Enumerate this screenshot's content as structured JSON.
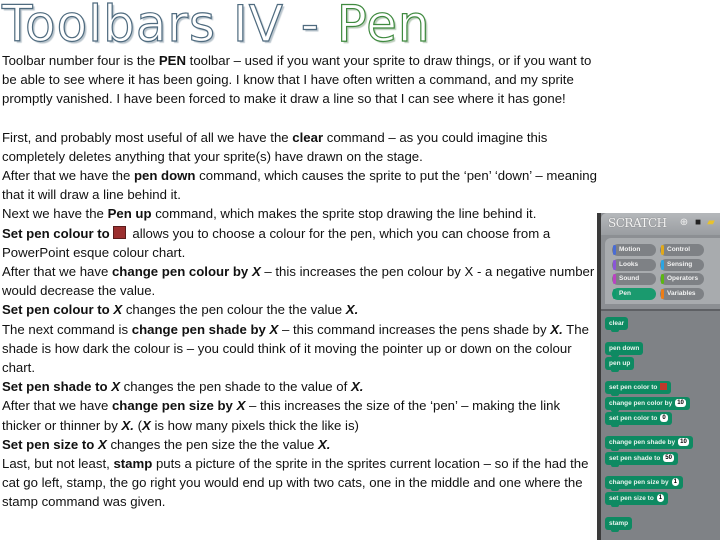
{
  "title": {
    "main": "Toolbars IV - ",
    "accent": "Pen"
  },
  "paragraphs": [
    [
      {
        "t": "Toolbar number four is the "
      },
      {
        "t": "PEN",
        "b": true
      },
      {
        "t": " toolbar – used if you want your sprite to draw things, or if you want to be able to see where it has been going.  I know that I have often written a command, and my sprite promptly vanished.  I have been forced to make it draw a line so that I can see where it has gone!"
      }
    ],
    null,
    [
      {
        "t": "First, and probably most useful of all we have the "
      },
      {
        "t": "clear",
        "b": true
      },
      {
        "t": " command – as you could imagine this completely deletes anything that your sprite(s) have drawn on the stage."
      }
    ],
    [
      {
        "t": "After that we have the "
      },
      {
        "t": "pen down",
        "b": true
      },
      {
        "t": " command, which causes the sprite to put the ‘pen’ ‘down’ – meaning that it will draw a line behind it."
      }
    ],
    [
      {
        "t": "Next we have the "
      },
      {
        "t": "Pen up",
        "b": true
      },
      {
        "t": " command, which makes the sprite stop drawing the line behind it."
      }
    ],
    [
      {
        "t": "Set pen colour to",
        "b": true
      },
      {
        "swatch": true
      },
      {
        "t": " allows you to choose a colour for the pen, which you can choose from a PowerPoint esque  colour chart."
      }
    ],
    [
      {
        "t": "After that we have "
      },
      {
        "t": "change pen colour by ",
        "b": true
      },
      {
        "t": "X",
        "b": true,
        "i": true
      },
      {
        "t": " – this increases the pen colour by X - a negative number would decrease the value."
      }
    ],
    [
      {
        "t": "Set pen colour to ",
        "b": true
      },
      {
        "t": "X",
        "b": true,
        "i": true
      },
      {
        "t": " changes the pen colour the the value "
      },
      {
        "t": "X.",
        "b": true,
        "i": true
      }
    ],
    [
      {
        "t": "The next command is "
      },
      {
        "t": "change pen shade by ",
        "b": true
      },
      {
        "t": "X",
        "b": true,
        "i": true
      },
      {
        "t": " – this command increases the pens shade by "
      },
      {
        "t": "X.",
        "b": true,
        "i": true
      },
      {
        "t": " The shade is how dark the colour is – you could think of it moving the pointer up or down on the colour chart."
      }
    ],
    [
      {
        "t": "Set pen shade to ",
        "b": true
      },
      {
        "t": "X",
        "b": true,
        "i": true
      },
      {
        "t": " changes the pen shade to the value of "
      },
      {
        "t": "X.",
        "b": true,
        "i": true
      }
    ],
    [
      {
        "t": "After that we have "
      },
      {
        "t": "change pen size by ",
        "b": true
      },
      {
        "t": "X",
        "b": true,
        "i": true
      },
      {
        "t": " – this increases the size of the ‘pen’ – making the link thicker or thinner by "
      },
      {
        "t": "X.",
        "b": true,
        "i": true
      },
      {
        "t": "  ("
      },
      {
        "t": "X",
        "b": true,
        "i": true
      },
      {
        "t": " is how many pixels thick the like is)"
      }
    ],
    [
      {
        "t": "Set pen size to ",
        "b": true
      },
      {
        "t": "X",
        "b": true,
        "i": true
      },
      {
        "t": " changes the pen size the the value "
      },
      {
        "t": "X.",
        "b": true,
        "i": true
      }
    ],
    [
      {
        "t": "Last, but not least, "
      },
      {
        "t": "stamp",
        "b": true
      },
      {
        "t": " puts a picture of the sprite in the sprites current location – so if the had the cat go left, stamp, the go right you would end up with two cats, one in the middle and one where the stamp command was given."
      }
    ]
  ],
  "swatch_color": "#9b2f2f",
  "scratch": {
    "logo": "SCRATCH",
    "header_icons": [
      "globe-icon",
      "save-icon",
      "folder-icon"
    ],
    "categories": [
      {
        "label": "Motion",
        "color": "#4a6cd4"
      },
      {
        "label": "Control",
        "color": "#e1a91a"
      },
      {
        "label": "Looks",
        "color": "#8a55d7"
      },
      {
        "label": "Sensing",
        "color": "#2ca5e2"
      },
      {
        "label": "Sound",
        "color": "#bb42c3"
      },
      {
        "label": "Operators",
        "color": "#5cb712"
      },
      {
        "label": "Pen",
        "color": "#0e9a6c",
        "active": true
      },
      {
        "label": "Variables",
        "color": "#ee7d16"
      }
    ],
    "blocks": [
      {
        "label": "clear"
      },
      {
        "label": "pen down"
      },
      {
        "label": "pen up"
      },
      {
        "label": "set pen color to",
        "color_slot": "#c0392b"
      },
      {
        "label": "change pen color by",
        "value": "10"
      },
      {
        "label": "set pen color to",
        "value": "0"
      },
      {
        "label": "change pen shade by",
        "value": "10"
      },
      {
        "label": "set pen shade to",
        "value": "50"
      },
      {
        "label": "change pen size by",
        "value": "1",
        "round": true
      },
      {
        "label": "set pen size to",
        "value": "1",
        "round": true
      },
      {
        "label": "stamp"
      }
    ]
  }
}
